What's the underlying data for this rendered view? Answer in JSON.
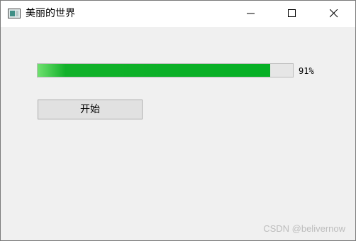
{
  "window": {
    "title": "美丽的世界",
    "icon": "app-window-icon",
    "controls": {
      "minimize_icon": "minimize-icon",
      "maximize_icon": "maximize-icon",
      "close_icon": "close-icon"
    }
  },
  "progress": {
    "value_fraction": 0.91,
    "label": "91%",
    "fill_color": "#06b025",
    "track_color": "#e6e6e6"
  },
  "start_button": {
    "label": "开始"
  },
  "watermark": "CSDN @belivernow"
}
